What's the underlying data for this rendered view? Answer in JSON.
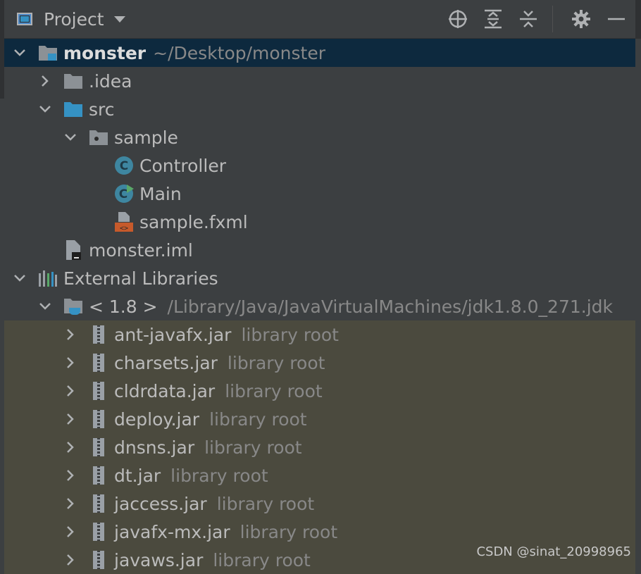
{
  "toolbar": {
    "title": "Project",
    "icons": [
      "locate-icon",
      "expand-all-icon",
      "collapse-all-icon",
      "gear-icon",
      "minimize-icon"
    ]
  },
  "tree": {
    "root": {
      "name": "monster",
      "path": "~/Desktop/monster"
    },
    "idea": {
      "name": ".idea"
    },
    "src": {
      "name": "src"
    },
    "sample": {
      "name": "sample"
    },
    "controller": {
      "name": "Controller"
    },
    "main": {
      "name": "Main"
    },
    "fxml": {
      "name": "sample.fxml"
    },
    "iml": {
      "name": "monster.iml"
    },
    "ext": {
      "name": "External Libraries"
    },
    "jdk": {
      "name": "< 1.8 >",
      "path": "/Library/Java/JavaVirtualMachines/jdk1.8.0_271.jdk"
    },
    "jars": [
      {
        "name": "ant-javafx.jar",
        "hint": "library root"
      },
      {
        "name": "charsets.jar",
        "hint": "library root"
      },
      {
        "name": "cldrdata.jar",
        "hint": "library root"
      },
      {
        "name": "deploy.jar",
        "hint": "library root"
      },
      {
        "name": "dnsns.jar",
        "hint": "library root"
      },
      {
        "name": "dt.jar",
        "hint": "library root"
      },
      {
        "name": "jaccess.jar",
        "hint": "library root"
      },
      {
        "name": "javafx-mx.jar",
        "hint": "library root"
      },
      {
        "name": "javaws.jar",
        "hint": "library root"
      }
    ]
  },
  "watermark": "CSDN @sinat_20998965",
  "colors": {
    "panel_bg": "#3c3f41",
    "selected_bg": "#0d293e",
    "library_bg": "#4b4a3e",
    "text": "#bbbbbb",
    "hint_text": "#888888",
    "folder_blue": "#3592c4",
    "folder_gray": "#8c9196"
  }
}
